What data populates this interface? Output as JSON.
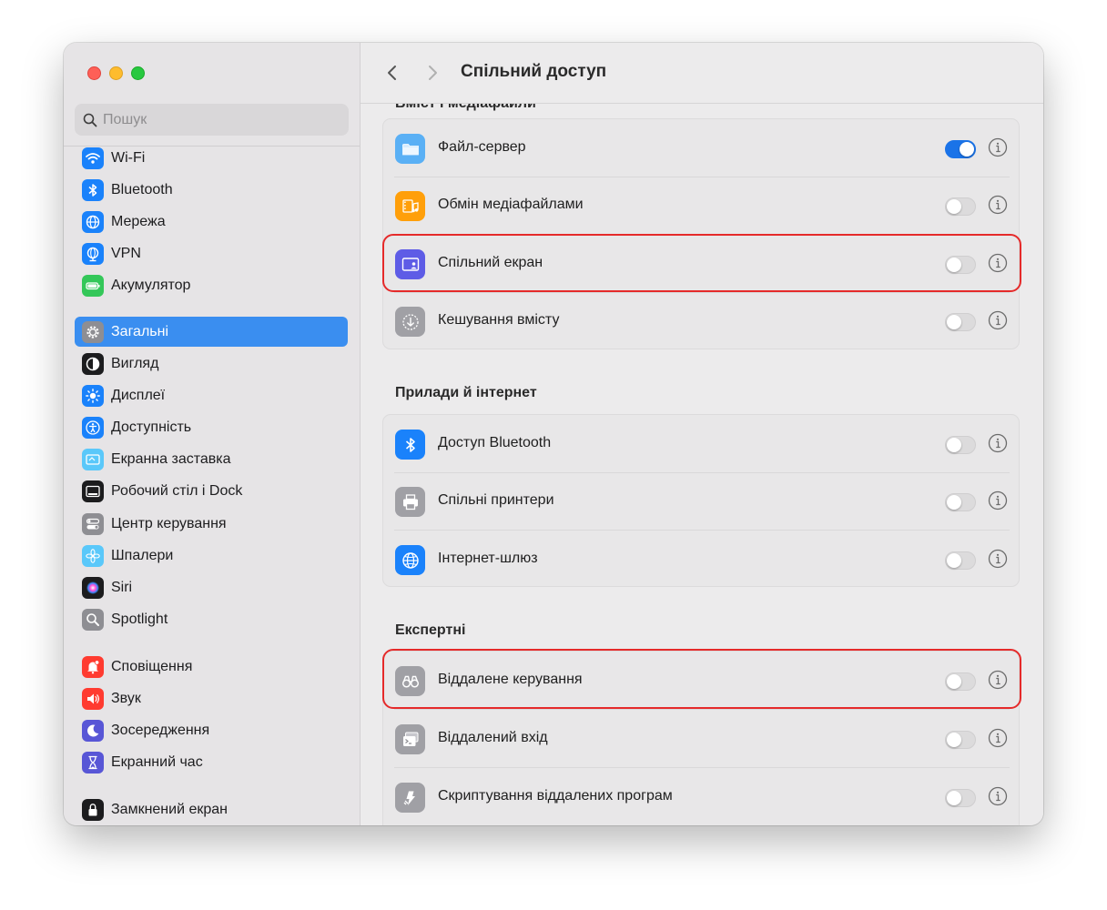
{
  "search": {
    "placeholder": "Пошук"
  },
  "sidebar": {
    "items": [
      {
        "label": "Wi-Fi",
        "icon": "wifi-icon",
        "color": "#1a82fb"
      },
      {
        "label": "Bluetooth",
        "icon": "bluetooth-icon",
        "color": "#1a82fb"
      },
      {
        "label": "Мережа",
        "icon": "globe-icon",
        "color": "#1a82fb"
      },
      {
        "label": "VPN",
        "icon": "vpn-globe-icon",
        "color": "#1a82fb"
      },
      {
        "label": "Акумулятор",
        "icon": "battery-icon",
        "color": "#34c759"
      },
      {
        "label": "Загальні",
        "icon": "gear-icon",
        "color": "#8e8e93",
        "selected": true
      },
      {
        "label": "Вигляд",
        "icon": "appearance-icon",
        "color": "#1c1c1e"
      },
      {
        "label": "Дисплеї",
        "icon": "sun-icon",
        "color": "#1a82fb"
      },
      {
        "label": "Доступність",
        "icon": "accessibility-icon",
        "color": "#1a82fb"
      },
      {
        "label": "Екранна заставка",
        "icon": "screensaver-icon",
        "color": "#5ac8fa"
      },
      {
        "label": "Робочий стіл і Dock",
        "icon": "dock-icon",
        "color": "#1c1c1e"
      },
      {
        "label": "Центр керування",
        "icon": "control-center-icon",
        "color": "#8e8e93"
      },
      {
        "label": "Шпалери",
        "icon": "flower-icon",
        "color": "#5ac8fa"
      },
      {
        "label": "Siri",
        "icon": "siri-icon",
        "color": "#1c1c1e"
      },
      {
        "label": "Spotlight",
        "icon": "magnifier-icon",
        "color": "#8e8e93"
      },
      {
        "label": "Сповіщення",
        "icon": "bell-icon",
        "color": "#ff3b30"
      },
      {
        "label": "Звук",
        "icon": "speaker-icon",
        "color": "#ff3b30"
      },
      {
        "label": "Зосередження",
        "icon": "moon-icon",
        "color": "#5856d6"
      },
      {
        "label": "Екранний час",
        "icon": "hourglass-icon",
        "color": "#5856d6"
      },
      {
        "label": "Замкнений екран",
        "icon": "lock-screen-icon",
        "color": "#1c1c1e"
      }
    ]
  },
  "main": {
    "title": "Спільний доступ",
    "clipped_header": "Вміст і медіафайли",
    "groups": [
      {
        "header": "",
        "rows": [
          {
            "label": "Файл-сервер",
            "icon": "folder-icon",
            "color": "#5ab0f5",
            "on": true
          },
          {
            "label": "Обмін медіафайлами",
            "icon": "media-icon",
            "color": "#ff9f0a",
            "on": false
          },
          {
            "label": "Спільний екран",
            "icon": "screen-share-icon",
            "color": "#5e5ce6",
            "on": false,
            "highlighted": true
          },
          {
            "label": "Кешування вмісту",
            "icon": "download-circle-icon",
            "color": "#a0a0a5",
            "on": false
          }
        ]
      },
      {
        "header": "Прилади й інтернет",
        "rows": [
          {
            "label": "Доступ Bluetooth",
            "icon": "bluetooth-icon",
            "color": "#1a82fb",
            "on": false
          },
          {
            "label": "Спільні принтери",
            "icon": "printer-icon",
            "color": "#a0a0a5",
            "on": false
          },
          {
            "label": "Інтернет-шлюз",
            "icon": "globe-icon",
            "color": "#1a82fb",
            "on": false
          }
        ]
      },
      {
        "header": "Експертні",
        "rows": [
          {
            "label": "Віддалене керування",
            "icon": "binoculars-icon",
            "color": "#a0a0a5",
            "on": false,
            "highlighted": true
          },
          {
            "label": "Віддалений вхід",
            "icon": "terminal-icon",
            "color": "#a0a0a5",
            "on": false
          },
          {
            "label": "Скриптування віддалених програм",
            "icon": "script-icon",
            "color": "#a0a0a5",
            "on": false
          }
        ]
      }
    ]
  }
}
